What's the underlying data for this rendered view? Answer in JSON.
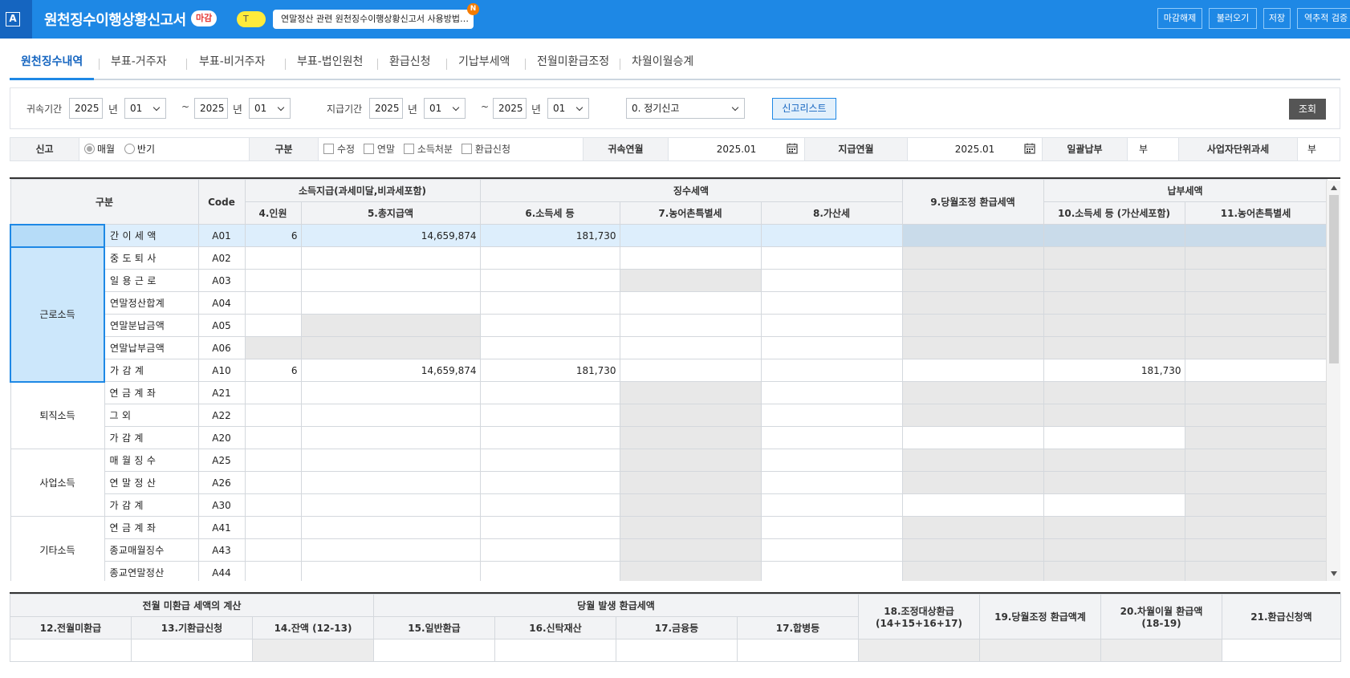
{
  "header": {
    "logo": "A",
    "title": "원천징수이행상황신고서",
    "status_badge": "마감",
    "tag": "T",
    "notice": "연말정산 관련 원천징수이행상황신고서 사용방법…",
    "notice_new": "N",
    "buttons": [
      "마감해제",
      "불러오기",
      "저장",
      "역추적 검증"
    ]
  },
  "tabs": [
    "원천징수내역",
    "부표-거주자",
    "부표-비거주자",
    "부표-법인원천",
    "환급신청",
    "기납부세액",
    "전월미환급조정",
    "차월이월승계"
  ],
  "filter": {
    "attribution_label": "귀속기간",
    "from_year": "2025",
    "from_month": "01",
    "to_year": "2025",
    "to_month": "01",
    "year_unit": "년",
    "tilde": "~",
    "payment_label": "지급기간",
    "pay_from_year": "2025",
    "pay_from_month": "01",
    "pay_to_year": "2025",
    "pay_to_month": "01",
    "report_type": "0. 정기신고",
    "report_list_button": "신고리스트",
    "query_button": "조회"
  },
  "info": {
    "report_label": "신고",
    "monthly": "매월",
    "half": "반기",
    "division_label": "구분",
    "checks": [
      "수정",
      "연말",
      "소득처분",
      "환급신청"
    ],
    "attr_month_label": "귀속연월",
    "attr_month": "2025.01",
    "pay_month_label": "지급연월",
    "pay_month": "2025.01",
    "lump_label": "일괄납부",
    "lump_value": "부",
    "unit_tax_label": "사업자단위과세",
    "unit_tax_value": "부"
  },
  "grid": {
    "headers": {
      "category": "구분",
      "code": "Code",
      "income_group": "소득지급(과세미달,비과세포함)",
      "withheld_group": "징수세액",
      "adjust": "9.당월조정 환급세액",
      "paid_group": "납부세액",
      "cols": [
        "4.인원",
        "5.총지급액",
        "6.소득세 등",
        "7.농어촌특별세",
        "8.가산세",
        "10.소득세 등 (가산세포함)",
        "11.농어촌특별세"
      ]
    },
    "groups": {
      "labor": "근로소득",
      "retire": "퇴직소득",
      "business": "사업소득",
      "other": "기타소득"
    },
    "rows": [
      {
        "label": "간 이 세 액",
        "code": "A01",
        "people": "6",
        "total": "14,659,874",
        "tax": "181,730",
        "paid": ""
      },
      {
        "label": "중 도 퇴 사",
        "code": "A02",
        "people": "",
        "total": "",
        "tax": "",
        "paid": ""
      },
      {
        "label": "일 용 근 로",
        "code": "A03",
        "people": "",
        "total": "",
        "tax": "",
        "paid": ""
      },
      {
        "label": "연말정산합계",
        "code": "A04",
        "people": "",
        "total": "",
        "tax": "",
        "paid": ""
      },
      {
        "label": "연말분납금액",
        "code": "A05",
        "people": "",
        "total": "",
        "tax": "",
        "paid": ""
      },
      {
        "label": "연말납부금액",
        "code": "A06",
        "people": "",
        "total": "",
        "tax": "",
        "paid": ""
      },
      {
        "label": "가  감  계",
        "code": "A10",
        "people": "6",
        "total": "14,659,874",
        "tax": "181,730",
        "paid": "181,730"
      },
      {
        "label": "연 금 계 좌",
        "code": "A21",
        "people": "",
        "total": "",
        "tax": "",
        "paid": ""
      },
      {
        "label": "그  외",
        "code": "A22",
        "people": "",
        "total": "",
        "tax": "",
        "paid": ""
      },
      {
        "label": "가 감 계",
        "code": "A20",
        "people": "",
        "total": "",
        "tax": "",
        "paid": ""
      },
      {
        "label": "매 월 징 수",
        "code": "A25",
        "people": "",
        "total": "",
        "tax": "",
        "paid": ""
      },
      {
        "label": "연 말 정 산",
        "code": "A26",
        "people": "",
        "total": "",
        "tax": "",
        "paid": ""
      },
      {
        "label": "가  감  계",
        "code": "A30",
        "people": "",
        "total": "",
        "tax": "",
        "paid": ""
      },
      {
        "label": "연 금 계 좌",
        "code": "A41",
        "people": "",
        "total": "",
        "tax": "",
        "paid": ""
      },
      {
        "label": "종교매월징수",
        "code": "A43",
        "people": "",
        "total": "",
        "tax": "",
        "paid": ""
      },
      {
        "label": "종교연말정산",
        "code": "A44",
        "people": "",
        "total": "",
        "tax": "",
        "paid": ""
      }
    ]
  },
  "bottom": {
    "prev_group": "전월 미환급 세액의 계산",
    "curr_group": "당월 발생 환급세액",
    "cols": [
      "12.전월미환급",
      "13.기환급신청",
      "14.잔액 (12-13)",
      "15.일반환급",
      "16.신탁재산",
      "17.금융등",
      "17.합병등"
    ],
    "col18": "18.조정대상환급",
    "col18_sub": "(14+15+16+17)",
    "col19": "19.당월조정 환급액계",
    "col20": "20.차월이월 환급액",
    "col20_sub": "(18-19)",
    "col21": "21.환급신청액"
  }
}
